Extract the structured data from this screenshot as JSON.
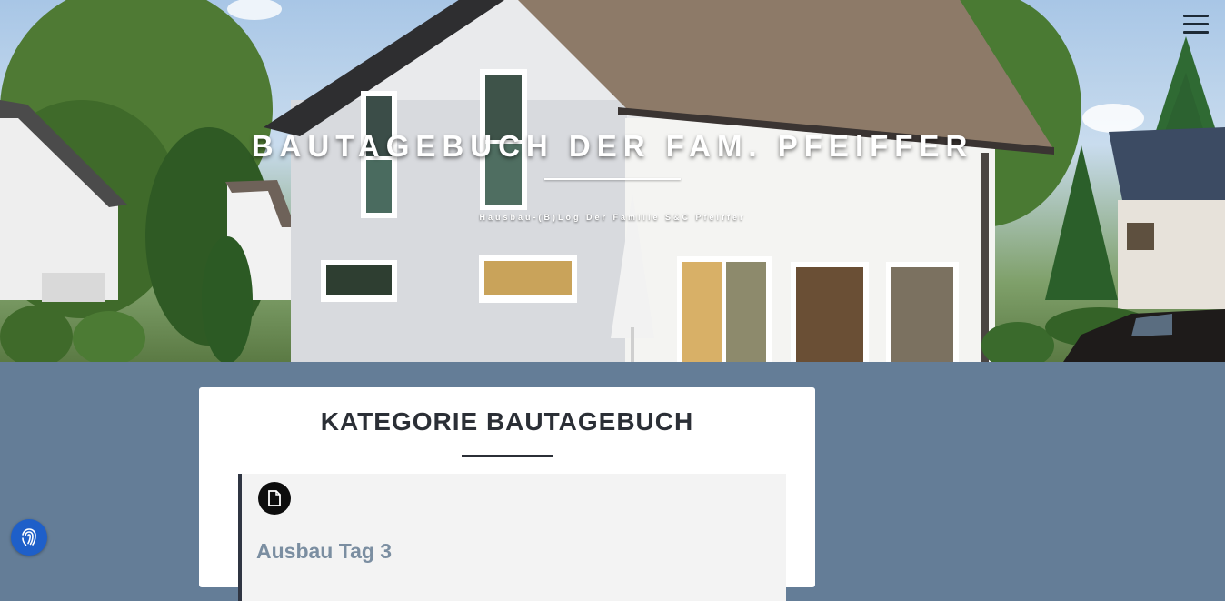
{
  "header": {
    "site_title": "BAUTAGEBUCH DER FAM. PFEIFFER",
    "site_subtitle": "Hausbau-(B)Log Der Familie S&C Pfeiffer",
    "menu_icon": "hamburger-menu-icon"
  },
  "main": {
    "category_title": "KATEGORIE BAUTAGEBUCH",
    "posts": [
      {
        "format_icon": "document-icon",
        "title": "Ausbau Tag 3"
      }
    ]
  },
  "privacy": {
    "icon": "fingerprint-icon"
  },
  "colors": {
    "page_background": "#647d97",
    "card_background": "#ffffff",
    "post_background": "#f3f3f3",
    "post_title": "#7b8ea1",
    "heading": "#2b2f36",
    "privacy_button": "#1e5fc9"
  }
}
